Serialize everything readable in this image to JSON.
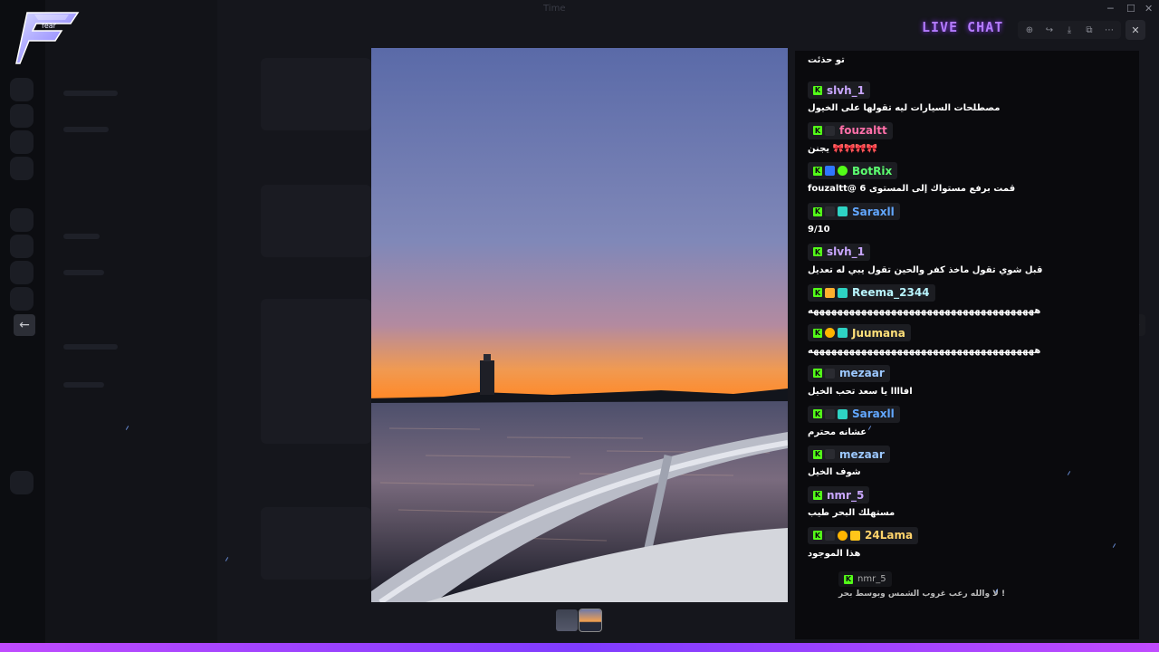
{
  "app": {
    "title": "Time",
    "logo_text": "fear"
  },
  "window_controls": {
    "minimize": "─",
    "maximize": "☐",
    "close": "✕"
  },
  "viewer": {
    "toolbar": [
      {
        "icon": "zoom-in-icon",
        "glyph": "⊕"
      },
      {
        "icon": "forward-icon",
        "glyph": "↪"
      },
      {
        "icon": "download-icon",
        "glyph": "⤓"
      },
      {
        "icon": "open-external-icon",
        "glyph": "⧉"
      },
      {
        "icon": "more-icon",
        "glyph": "⋯"
      }
    ],
    "close_glyph": "✕",
    "prev_glyph": "←",
    "next_glyph": "→",
    "thumbnails": 2,
    "selected_thumbnail": 2
  },
  "live_chat": {
    "title": "LIVE CHAT",
    "first_line": "تو حذئت",
    "messages": [
      {
        "user": "slvh_1",
        "color": "#c9a7ff",
        "badges": [
          "kick"
        ],
        "text": "مصطلحات السيارات ليه تقولها على الخيول"
      },
      {
        "user": "fouzaltt",
        "color": "#ff6fa8",
        "badges": [
          "kick",
          "blank"
        ],
        "text": "🎀🎀🎀🎀 يجنن"
      },
      {
        "user": "BotRix",
        "color": "#5cff70",
        "badges": [
          "kick",
          "bot",
          "verified"
        ],
        "text": "قمت برفع مستواك إلى المستوى 6 @fouzaltt"
      },
      {
        "user": "Saraxll",
        "color": "#62a7ff",
        "badges": [
          "kick",
          "blank",
          "gift"
        ],
        "text": "9/10"
      },
      {
        "user": "slvh_1",
        "color": "#c9a7ff",
        "badges": [
          "kick"
        ],
        "text": "قبل شوي تقول ماخذ كفر والحين تقول يبي له تعديل"
      },
      {
        "user": "Reema_2344",
        "color": "#b9f5ff",
        "badges": [
          "kick",
          "flag",
          "gift"
        ],
        "text": "ههههههههههههههههههههههههههههههههههههههه"
      },
      {
        "user": "Juumana",
        "color": "#ffe07a",
        "badges": [
          "kick",
          "one",
          "gift"
        ],
        "text": "ههههههههههههههههههههههههههههههههههههههه"
      },
      {
        "user": "mezaar",
        "color": "#9cc8ff",
        "badges": [
          "kick",
          "blank"
        ],
        "text": "افاااا يا سعد تحب الخيل"
      },
      {
        "user": "Saraxll",
        "color": "#62a7ff",
        "badges": [
          "kick",
          "blank",
          "gift"
        ],
        "text": "عشانه محترم"
      },
      {
        "user": "mezaar",
        "color": "#9cc8ff",
        "badges": [
          "kick",
          "blank"
        ],
        "text": "شوف الخيل"
      },
      {
        "user": "nmr_5",
        "color": "#c9a7ff",
        "badges": [
          "kick"
        ],
        "text": "مستهلك البحر طيب"
      },
      {
        "user": "24Lama",
        "color": "#ffd36b",
        "badges": [
          "kick",
          "blank",
          "one",
          "crown"
        ],
        "text": "هذا الموجود"
      }
    ],
    "pinned": {
      "user": "nmr_5",
      "text": "! لا والله رعب غروب الشمس وبوسط بحر"
    }
  },
  "colors": {
    "accent": "#b47bff",
    "kick_green": "#53fc18",
    "bottom_bar": "#a44bff"
  }
}
